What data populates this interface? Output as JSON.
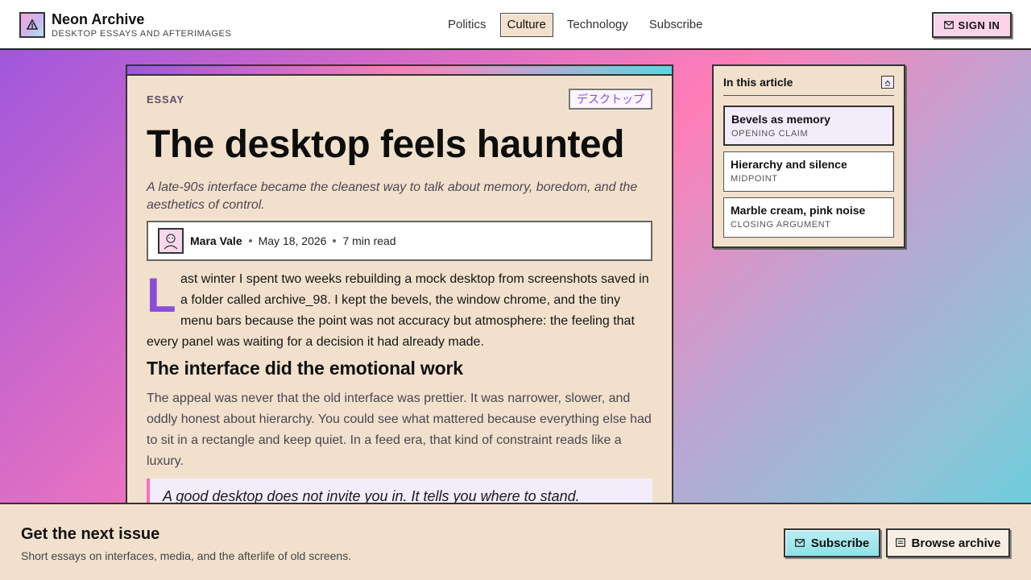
{
  "header": {
    "brand_title": "Neon Archive",
    "brand_subtitle": "DESKTOP ESSAYS AND AFTERIMAGES",
    "nav": [
      {
        "label": "Politics",
        "active": false
      },
      {
        "label": "Culture",
        "active": true
      },
      {
        "label": "Technology",
        "active": false
      },
      {
        "label": "Subscribe",
        "active": false
      }
    ],
    "signin_label": "SIGN IN"
  },
  "article": {
    "kicker": "ESSAY",
    "tag": "デスクトップ",
    "headline": "The desktop feels haunted",
    "dek": "A late-90s interface became the cleanest way to talk about memory, boredom, and the aesthetics of control.",
    "author": "Mara Vale",
    "date": "May 18, 2026",
    "read_time": "7 min read",
    "dropcap": "L",
    "paragraph1": "ast winter I spent two weeks rebuilding a mock desktop from screenshots saved in a folder called archive_98. I kept the bevels, the window chrome, and the tiny menu bars because the point was not accuracy but atmosphere: the feeling that every panel was waiting for a decision it had already made.",
    "subhead": "The interface did the emotional work",
    "paragraph2": "The appeal was never that the old interface was prettier. It was narrower, slower, and oddly honest about hierarchy. You could see what mattered because everything else had to sit in a rectangle and keep quiet. In a feed era, that kind of constraint reads like a luxury.",
    "pullquote": "A good desktop does not invite you in. It tells you where to stand."
  },
  "toc": {
    "title": "In this article",
    "items": [
      {
        "label": "Bevels as memory",
        "sub": "OPENING CLAIM",
        "active": true
      },
      {
        "label": "Hierarchy and silence",
        "sub": "MIDPOINT",
        "active": false
      },
      {
        "label": "Marble cream, pink noise",
        "sub": "CLOSING ARGUMENT",
        "active": false
      }
    ]
  },
  "footer": {
    "title": "Get the next issue",
    "subtitle": "Short essays on interfaces, media, and the afterlife of old screens.",
    "subscribe_label": "Subscribe",
    "browse_label": "Browse archive"
  },
  "colors": {
    "accent_purple": "#8a4fd6",
    "accent_pink": "#ff6fb5",
    "panel_cream": "#f1e1cc",
    "cyan_button": "#8fe1e8"
  }
}
